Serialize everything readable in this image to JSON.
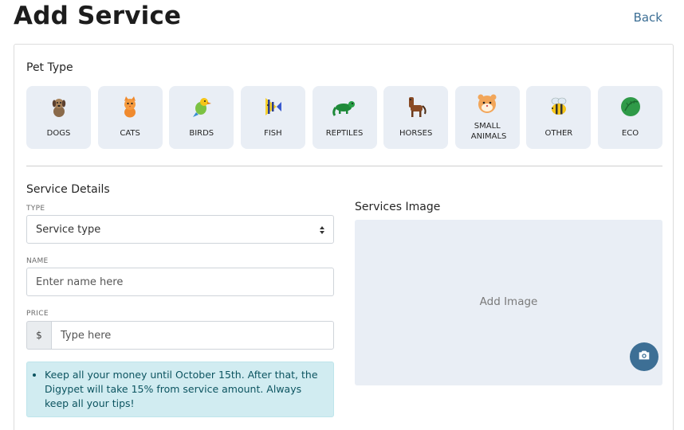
{
  "header": {
    "title": "Add Service",
    "back_label": "Back"
  },
  "pet_type": {
    "heading": "Pet Type",
    "items": [
      {
        "label": "DOGS",
        "icon": "dog-icon"
      },
      {
        "label": "CATS",
        "icon": "cat-icon"
      },
      {
        "label": "BIRDS",
        "icon": "bird-icon"
      },
      {
        "label": "FISH",
        "icon": "fish-icon"
      },
      {
        "label": "REPTILES",
        "icon": "reptile-icon"
      },
      {
        "label": "HORSES",
        "icon": "horse-icon"
      },
      {
        "label": "SMALL ANIMALS",
        "icon": "hamster-icon"
      },
      {
        "label": "OTHER",
        "icon": "bee-icon"
      },
      {
        "label": "ECO",
        "icon": "leaf-icon"
      }
    ]
  },
  "service_details": {
    "heading": "Service Details",
    "type_caption": "TYPE",
    "type_value": "Service type",
    "name_caption": "NAME",
    "name_placeholder": "Enter name here",
    "price_caption": "PRICE",
    "price_prefix": "$",
    "price_placeholder": "Type here",
    "notice": "Keep all your money until October 15th. After that, the Digypet will take 15% from service amount. Always keep all your tips!"
  },
  "services_image": {
    "heading": "Services Image",
    "placeholder": "Add Image",
    "upload_icon": "camera-icon"
  },
  "colors": {
    "accent": "#3d6f95",
    "tile_bg": "#e9eef5",
    "info_bg": "#d1ecf1",
    "info_text": "#0c5460"
  }
}
